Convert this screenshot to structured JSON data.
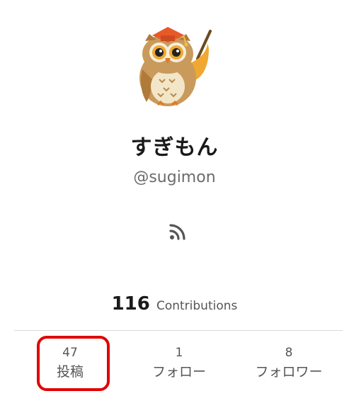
{
  "profile": {
    "display_name": "すぎもん",
    "handle": "@sugimon",
    "avatar_icon": "owl-teacher-icon",
    "rss_icon": "rss-icon"
  },
  "contributions": {
    "count": "116",
    "label": "Contributions"
  },
  "stats": [
    {
      "count": "47",
      "label": "投稿"
    },
    {
      "count": "1",
      "label": "フォロー"
    },
    {
      "count": "8",
      "label": "フォロワー"
    }
  ],
  "colors": {
    "highlight": "#e00000",
    "text_primary": "#1a1a1a",
    "text_secondary": "#555555"
  }
}
